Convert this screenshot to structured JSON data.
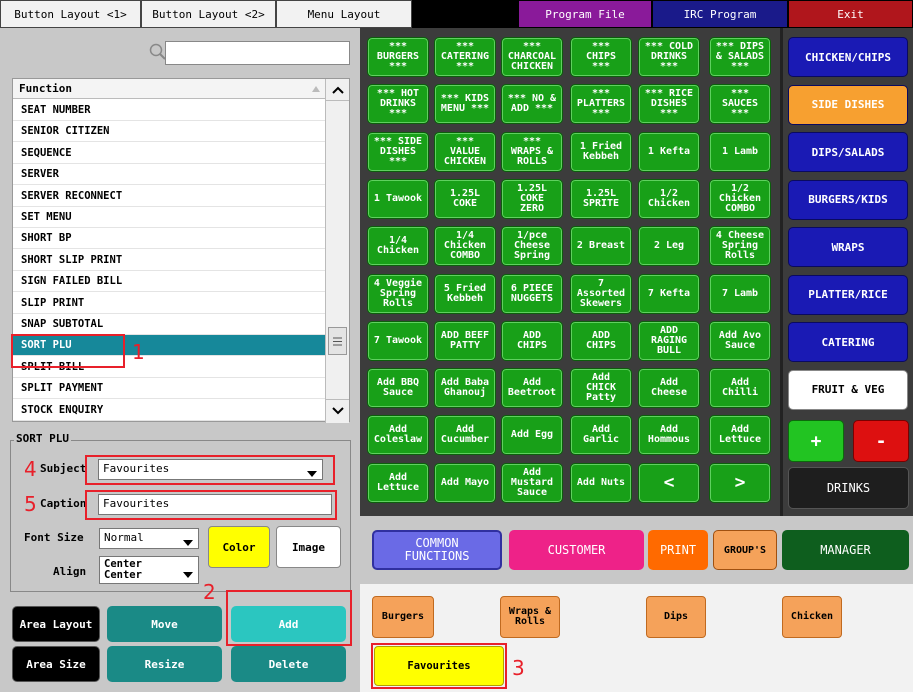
{
  "toolbar": {
    "button_layout_1": "Button Layout <1>",
    "button_layout_2": "Button Layout <2>",
    "menu_layout": "Menu Layout",
    "program_file": "Program File",
    "irc_program": "IRC Program",
    "exit": "Exit"
  },
  "function_list": {
    "header": "Function",
    "items": [
      "SEAT NUMBER",
      "SENIOR CITIZEN",
      "SEQUENCE",
      "SERVER",
      "SERVER RECONNECT",
      "SET MENU",
      "SHORT BP",
      "SHORT SLIP PRINT",
      "SIGN FAILED BILL",
      "SLIP PRINT",
      "SNAP SUBTOTAL",
      "SORT PLU",
      "SPLIT BILL",
      "SPLIT PAYMENT",
      "STOCK ENQUIRY"
    ],
    "selected_index": 11
  },
  "properties": {
    "group_title": "SORT PLU",
    "subject_label": "Subject",
    "subject_value": "Favourites",
    "caption_label": "Caption",
    "caption_value": "Favourites",
    "font_size_label": "Font Size",
    "font_size_value": "Normal",
    "color_button": "Color",
    "image_button": "Image",
    "align_label": "Align",
    "align_line1": "Center",
    "align_line2": "Center"
  },
  "actions": {
    "area_layout": "Area Layout",
    "move": "Move",
    "add": "Add",
    "area_size": "Area Size",
    "resize": "Resize",
    "delete": "Delete"
  },
  "grid_buttons": [
    "*** \nBURGERS\n***",
    "***\nCATERING\n***",
    "***\nCHARCOAL\nCHICKEN",
    "***\nCHIPS\n***",
    "*** COLD\nDRINKS\n***",
    "*** DIPS\n& SALADS\n***",
    "*** HOT\nDRINKS\n***",
    "*** KIDS\nMENU ***",
    "*** NO &\nADD ***",
    "***\nPLATTERS\n***",
    "*** RICE\nDISHES\n***",
    "***\nSAUCES\n***",
    "*** SIDE\nDISHES\n***",
    "***\nVALUE\nCHICKEN",
    "***\nWRAPS &\nROLLS",
    "1 Fried\nKebbeh",
    "1 Kefta",
    "1 Lamb",
    "1 Tawook",
    "1.25L\nCOKE",
    "1.25L\nCOKE\nZERO",
    "1.25L\nSPRITE",
    "1/2\nChicken",
    "1/2\nChicken\nCOMBO",
    "1/4\nChicken",
    "1/4\nChicken\nCOMBO",
    "1/pce\nCheese\nSpring",
    "2 Breast",
    "2 Leg",
    "4 Cheese\nSpring\nRolls",
    "4 Veggie\nSpring\nRolls",
    "5 Fried\nKebbeh",
    "6 PIECE\nNUGGETS",
    "7\nAssorted\nSkewers",
    "7 Kefta",
    "7 Lamb",
    "7 Tawook",
    "ADD BEEF\nPATTY",
    "ADD\nCHIPS",
    "ADD\nCHIPS",
    "ADD\nRAGING\nBULL",
    "Add Avo\nSauce",
    "Add BBQ\nSauce",
    "Add Baba\nGhanouj",
    "Add\nBeetroot",
    "Add\nCHICK\nPatty",
    "Add\nCheese",
    "Add\nChilli",
    "Add\nColeslaw",
    "Add\nCucumber",
    "Add Egg",
    "Add\nGarlic",
    "Add\nHommous",
    "Add\nLettuce",
    "Add\nLettuce",
    "Add Mayo",
    "Add\nMustard\nSauce",
    "Add Nuts",
    "<",
    ">"
  ],
  "categories": {
    "items": [
      {
        "label": "CHICKEN/CHIPS",
        "bg": "#1a1ab4",
        "fg": "#ffffff"
      },
      {
        "label": "SIDE DISHES",
        "bg": "#f7a030",
        "fg": "#ffffff"
      },
      {
        "label": "DIPS/SALADS",
        "bg": "#1a1ab4",
        "fg": "#ffffff"
      },
      {
        "label": "BURGERS/KIDS",
        "bg": "#1a1ab4",
        "fg": "#ffffff"
      },
      {
        "label": "WRAPS",
        "bg": "#1a1ab4",
        "fg": "#ffffff"
      },
      {
        "label": "PLATTER/RICE",
        "bg": "#1a1ab4",
        "fg": "#ffffff"
      },
      {
        "label": "CATERING",
        "bg": "#1a1ab4",
        "fg": "#ffffff"
      },
      {
        "label": "FRUIT & VEG",
        "bg": "#ffffff",
        "fg": "#000000"
      }
    ],
    "plus": "+",
    "minus": "-",
    "drinks": "DRINKS"
  },
  "bottom_bar": {
    "common_functions": "COMMON\nFUNCTIONS",
    "customer": "CUSTOMER",
    "print": "PRINT",
    "groups": "GROUP'S",
    "manager": "MANAGER"
  },
  "favourites_bar": {
    "burgers": "Burgers",
    "wraps_rolls": "Wraps &\nRolls",
    "dips": "Dips",
    "chicken": "Chicken",
    "favourites": "Favourites"
  },
  "annotations": [
    "1",
    "2",
    "3",
    "4",
    "5"
  ],
  "colors": {
    "green": "#18a018",
    "teal": "#1a8a86",
    "selected_teal": "#16889a",
    "annotation_red": "#e8202a"
  }
}
